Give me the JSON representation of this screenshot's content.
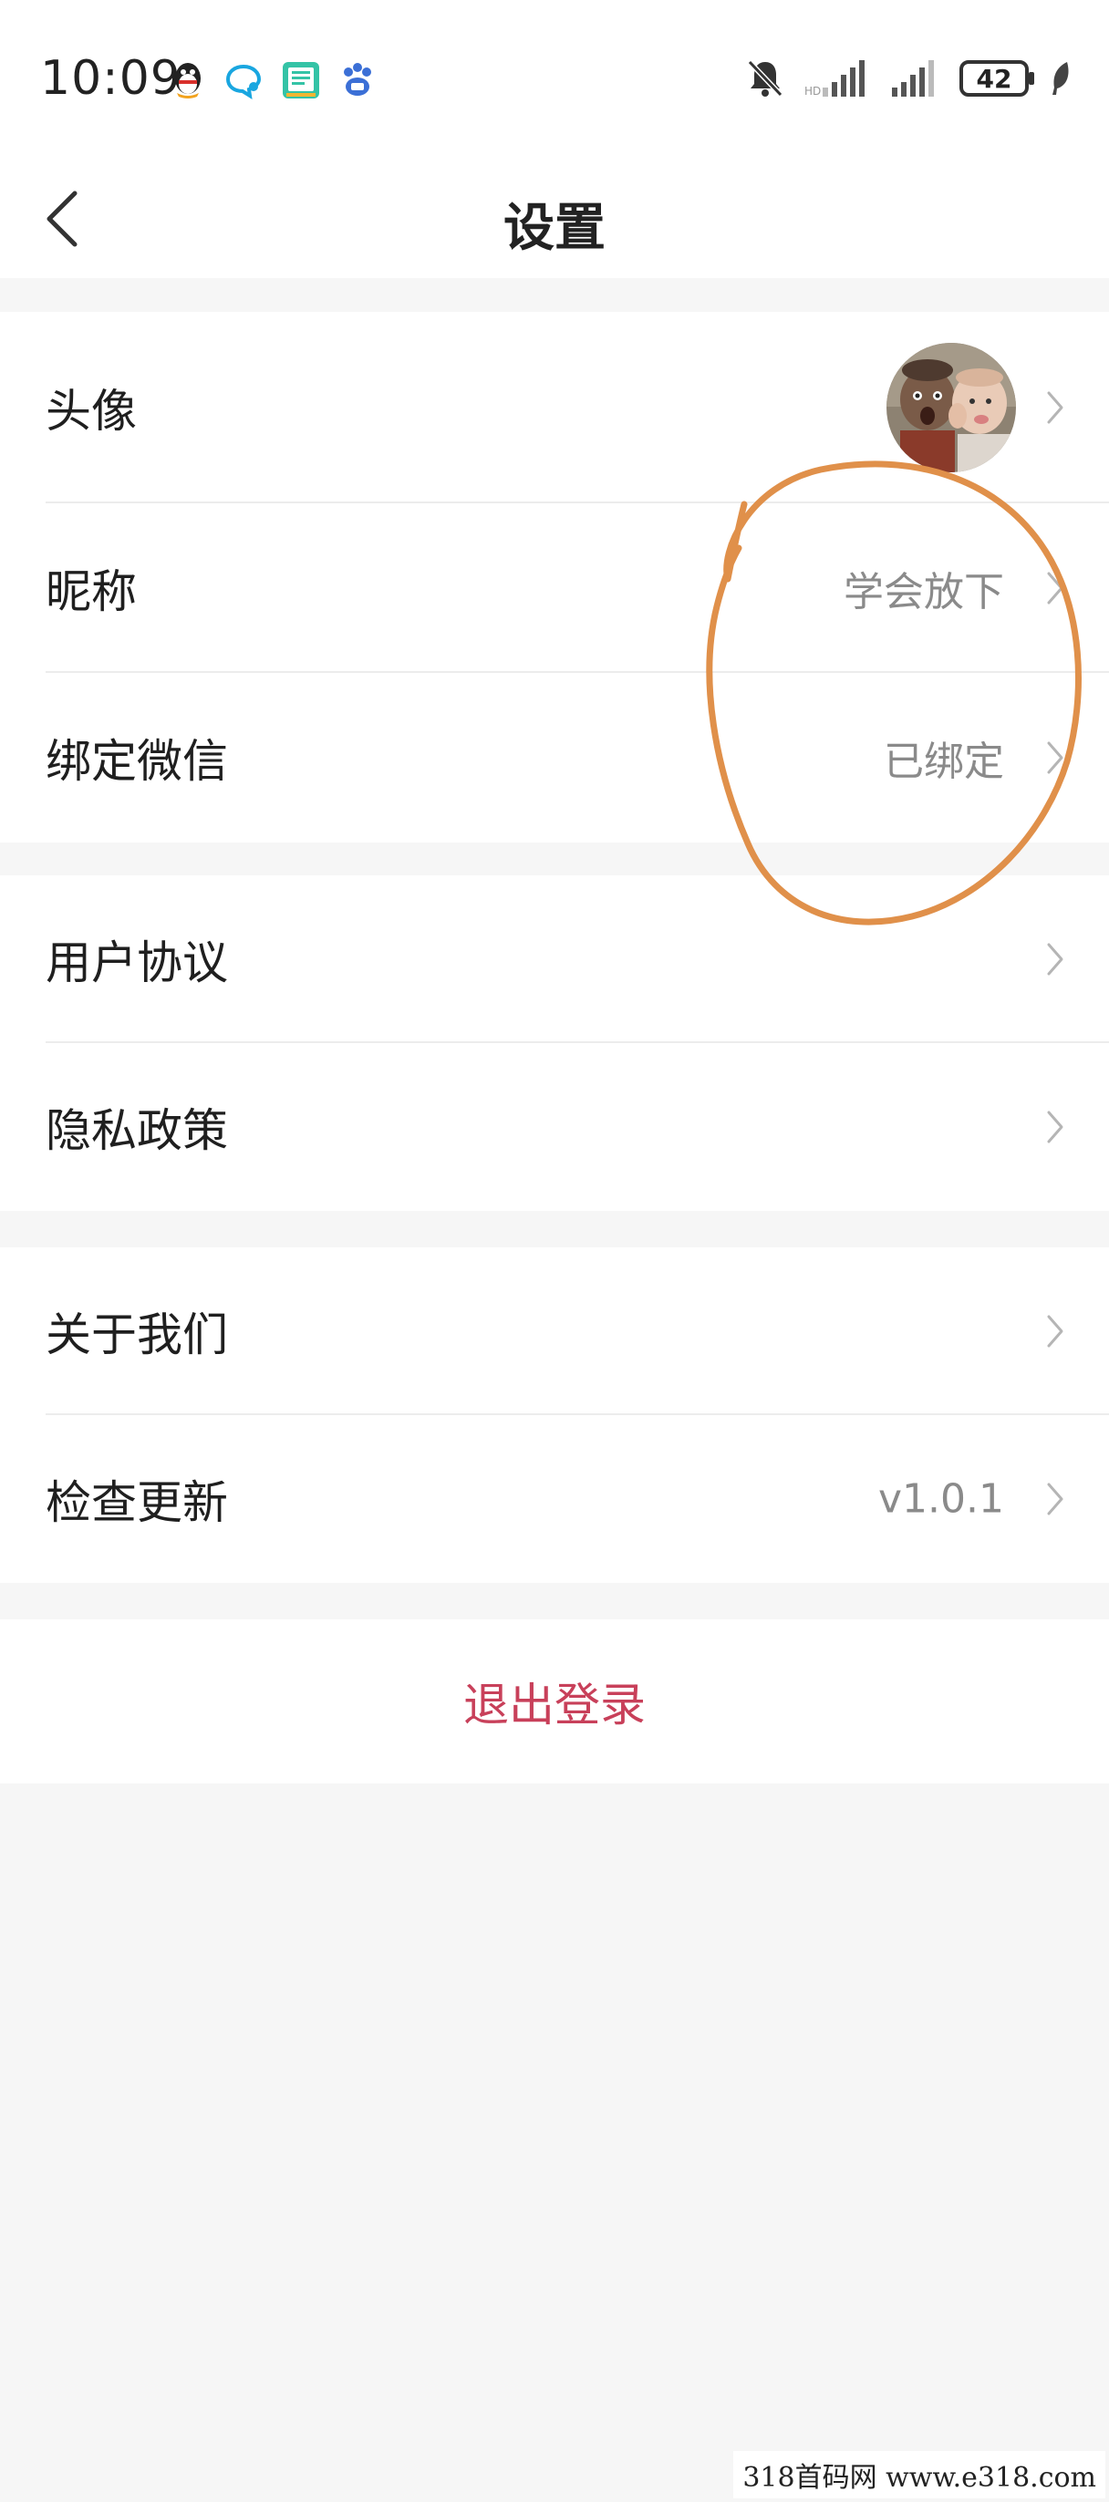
{
  "status_bar": {
    "time": "10:09",
    "battery_level": "42",
    "left_icons": [
      "qq-icon",
      "message-bubble-icon",
      "reading-app-icon",
      "baidu-paw-icon"
    ],
    "right_icons": [
      "bell-muted-icon",
      "signal-icon",
      "signal-icon",
      "battery-icon",
      "leaf-icon"
    ]
  },
  "header": {
    "title": "设置",
    "back_icon": "chevron-left-icon"
  },
  "groups": {
    "profile": {
      "avatar_label": "头像",
      "nickname_label": "昵称",
      "nickname_value": "学会放下",
      "wechat_label": "绑定微信",
      "wechat_value": "已绑定"
    },
    "legal": {
      "agreement_label": "用户协议",
      "privacy_label": "隐私政策"
    },
    "about": {
      "about_label": "关于我们",
      "update_label": "检查更新",
      "update_value": "v1.0.1"
    }
  },
  "logout": {
    "label": "退出登录"
  },
  "colors": {
    "background": "#f6f6f6",
    "card": "#ffffff",
    "logout_text": "#c8405a",
    "annotation_stroke": "#e0904a",
    "secondary_text": "#8a8a8a"
  },
  "watermark": {
    "text": "318首码网 www.e318.com"
  }
}
